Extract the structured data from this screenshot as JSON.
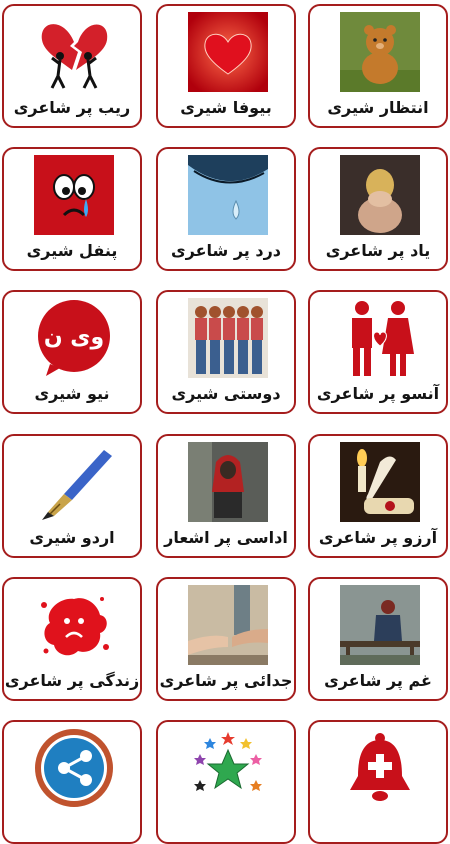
{
  "colors": {
    "border": "#a51d1d",
    "label": "#141414",
    "background": "#ffffff"
  },
  "grid": {
    "items": [
      {
        "label": "ریب پر شاعری",
        "icon": "broken-heart-couple-icon"
      },
      {
        "label": "بیوفا شیری",
        "icon": "red-heart-icon"
      },
      {
        "label": "انتظار شیری",
        "icon": "teddy-bear-image"
      },
      {
        "label": "پنفل شیری",
        "icon": "crying-face-icon"
      },
      {
        "label": "درد پر شاعری",
        "icon": "teardrop-eye-image"
      },
      {
        "label": "یاد پر شاعری",
        "icon": "sad-girl-image"
      },
      {
        "label": "نیو شیری",
        "icon": "speech-bubble-logo-icon"
      },
      {
        "label": "دوستی شیری",
        "icon": "friends-group-image"
      },
      {
        "label": "آنسو پر شاعری",
        "icon": "couple-heart-icon"
      },
      {
        "label": "اردو شیری",
        "icon": "fountain-pen-icon"
      },
      {
        "label": "اداسی پر اشعار",
        "icon": "hooded-boy-image"
      },
      {
        "label": "آرزو پر شاعری",
        "icon": "candle-scroll-image"
      },
      {
        "label": "زندگی پر شاعری",
        "icon": "red-splash-face-icon"
      },
      {
        "label": "جدائی پر شاعری",
        "icon": "parting-hands-image"
      },
      {
        "label": "غم پر شاعری",
        "icon": "sad-person-bench-image"
      },
      {
        "label": "",
        "icon": "share-icon"
      },
      {
        "label": "",
        "icon": "stars-rate-icon"
      },
      {
        "label": "",
        "icon": "notification-bell-icon"
      }
    ],
    "logo_text": "وی ن"
  }
}
